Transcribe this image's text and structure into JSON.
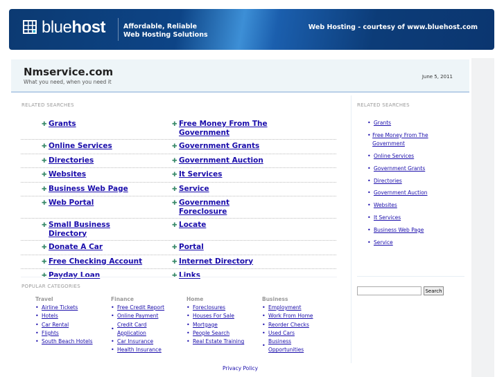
{
  "banner": {
    "logo_regular": "blue",
    "logo_bold": "host",
    "tagline_line1": "Affordable, Reliable",
    "tagline_line2": "Web Hosting Solutions",
    "courtesy": "Web Hosting - courtesy of www.bluehost.com"
  },
  "header": {
    "title": "Nmservice.com",
    "subtitle": "What you need, when you need it",
    "date": "June 5, 2011"
  },
  "main": {
    "section_label": "RELATED SEARCHES",
    "rows": [
      [
        "Grants",
        "Free Money From The Government"
      ],
      [
        "Online Services",
        "Government Grants"
      ],
      [
        "Directories",
        "Government Auction"
      ],
      [
        "Websites",
        "It Services"
      ],
      [
        "Business Web Page",
        "Service"
      ],
      [
        "Web Portal",
        "Government Foreclosure"
      ],
      [
        "Small Business Directory",
        "Locate"
      ],
      [
        "Donate A Car",
        "Portal"
      ],
      [
        "Free Checking Account",
        "Internet Directory"
      ],
      [
        "Payday Loan",
        "Links"
      ]
    ]
  },
  "sidebar": {
    "section_label": "RELATED SEARCHES",
    "items": [
      "Grants",
      "Free Money From The Government",
      "Online Services",
      "Government Grants",
      "Directories",
      "Government Auction",
      "Websites",
      "It Services",
      "Business Web Page",
      "Service"
    ],
    "search_button": "Search",
    "search_value": ""
  },
  "popular": {
    "section_label": "POPULAR CATEGORIES",
    "categories": [
      {
        "title": "Travel",
        "items": [
          "Airline Tickets",
          "Hotels",
          "Car Rental",
          "Flights",
          "South Beach Hotels"
        ]
      },
      {
        "title": "Finance",
        "items": [
          "Free Credit Report",
          "Online Payment",
          "Credit Card Application",
          "Car Insurance",
          "Health Insurance"
        ]
      },
      {
        "title": "Home",
        "items": [
          "Foreclosures",
          "Houses For Sale",
          "Mortgage",
          "People Search",
          "Real Estate Training"
        ]
      },
      {
        "title": "Business",
        "items": [
          "Employment",
          "Work From Home",
          "Reorder Checks",
          "Used Cars",
          "Business Opportunities"
        ]
      }
    ]
  },
  "footer": {
    "privacy": "Privacy Policy"
  },
  "colors": {
    "banner": "#0d4486",
    "header_bg": "#eef5f8",
    "link": "#1a0dab"
  }
}
